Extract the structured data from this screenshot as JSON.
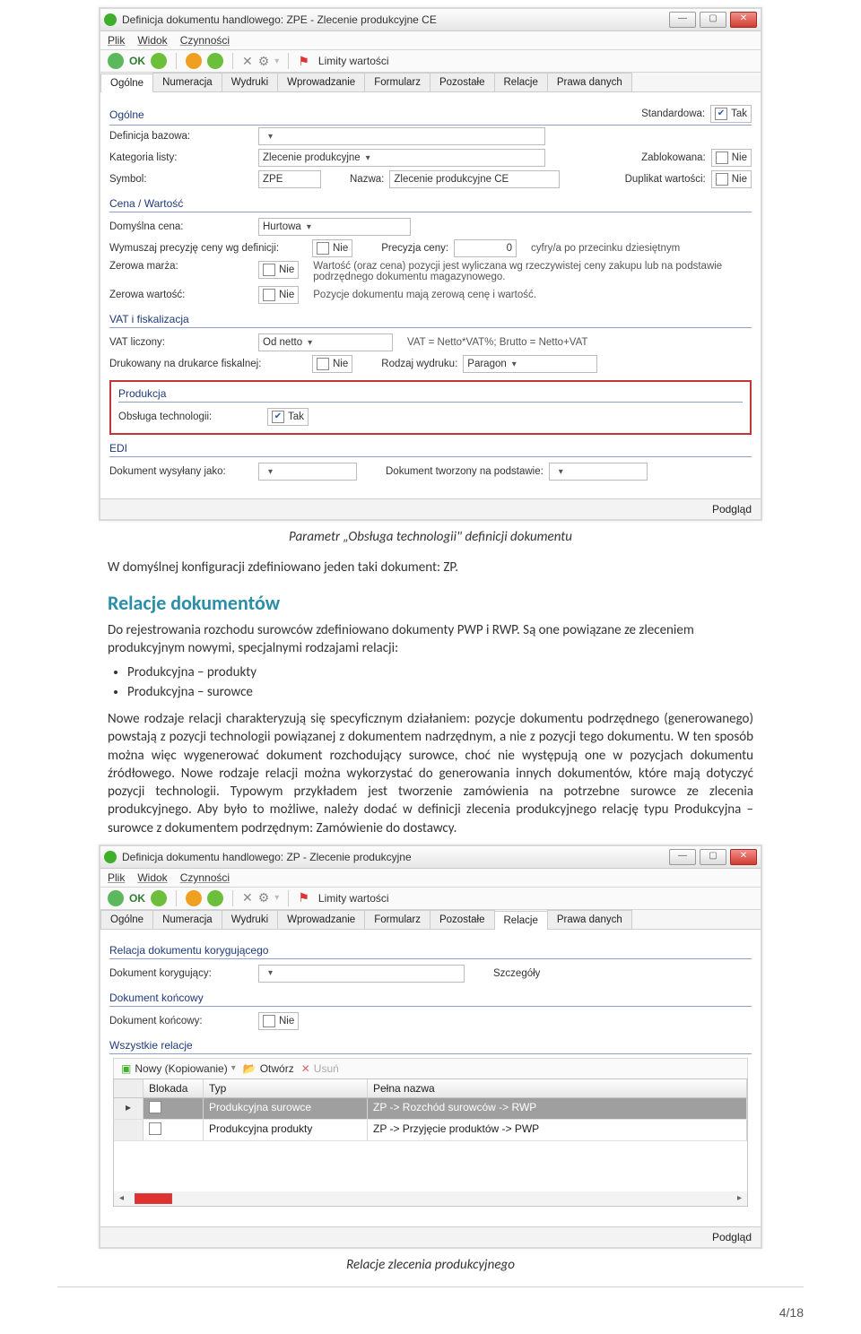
{
  "shot1": {
    "title": "Definicja dokumentu handlowego: ZPE - Zlecenie produkcyjne CE",
    "menu": [
      "Plik",
      "Widok",
      "Czynności"
    ],
    "toolbar": {
      "ok": "OK",
      "limity": "Limity wartości"
    },
    "tabs": [
      "Ogólne",
      "Numeracja",
      "Wydruki",
      "Wprowadzanie",
      "Formularz",
      "Pozostałe",
      "Relacje",
      "Prawa danych"
    ],
    "group_ogolne": "Ogólne",
    "standardowa_lbl": "Standardowa:",
    "standardowa_val": "Tak",
    "def_bazowa_lbl": "Definicja bazowa:",
    "kategoria_lbl": "Kategoria listy:",
    "kategoria_val": "Zlecenie produkcyjne",
    "zablokowana_lbl": "Zablokowana:",
    "zablokowana_val": "Nie",
    "symbol_lbl": "Symbol:",
    "symbol_val": "ZPE",
    "nazwa_lbl": "Nazwa:",
    "nazwa_val": "Zlecenie produkcyjne CE",
    "duplikat_lbl": "Duplikat wartości:",
    "duplikat_val": "Nie",
    "group_cena": "Cena / Wartość",
    "cena_lbl": "Domyślna cena:",
    "cena_val": "Hurtowa",
    "precyzja_def_lbl": "Wymuszaj precyzję ceny wg definicji:",
    "precyzja_def_val": "Nie",
    "precyzja_lbl": "Precyzja ceny:",
    "precyzja_val": "0",
    "precyzja_note": "cyfry/a po przecinku dziesiętnym",
    "zerowa_marza_lbl": "Zerowa marża:",
    "zerowa_marza_val": "Nie",
    "zerowa_marza_note": "Wartość (oraz cena) pozycji jest wyliczana wg rzeczywistej ceny zakupu lub na podstawie podrzędnego dokumentu magazynowego.",
    "zerowa_wartosc_lbl": "Zerowa wartość:",
    "zerowa_wartosc_val": "Nie",
    "zerowa_wartosc_note": "Pozycje dokumentu mają zerową cenę i wartość.",
    "group_vat": "VAT i fiskalizacja",
    "vat_liczony_lbl": "VAT liczony:",
    "vat_liczony_val": "Od netto",
    "vat_note": "VAT = Netto*VAT%; Brutto = Netto+VAT",
    "drukarka_lbl": "Drukowany na drukarce fiskalnej:",
    "drukarka_val": "Nie",
    "rodzaj_wydruku_lbl": "Rodzaj wydruku:",
    "rodzaj_wydruku_val": "Paragon",
    "group_produkcja": "Produkcja",
    "obsluga_tech_lbl": "Obsługa technologii:",
    "obsluga_tech_val": "Tak",
    "group_edi": "EDI",
    "edi_wysylany_lbl": "Dokument wysyłany jako:",
    "edi_tworzony_lbl": "Dokument tworzony na podstawie:",
    "podglad": "Podgląd"
  },
  "doc": {
    "caption1": "Parametr „Obsługa technologii\" definicji dokumentu",
    "p1": "W domyślnej konfiguracji zdefiniowano jeden taki dokument: ZP.",
    "h2": "Relacje dokumentów",
    "p2": "Do rejestrowania rozchodu surowców zdefiniowano dokumenty PWP i RWP. Są one powiązane ze zleceniem produkcyjnym nowymi, specjalnymi rodzajami relacji:",
    "li1": "Produkcyjna – produkty",
    "li2": "Produkcyjna – surowce",
    "p3": "Nowe rodzaje relacji charakteryzują się specyficznym działaniem: pozycje dokumentu podrzędnego (generowanego) powstają z pozycji technologii powiązanej z dokumentem nadrzędnym, a nie z pozycji tego dokumentu. W ten sposób można więc wygenerować dokument rozchodujący surowce, choć nie występują one w pozycjach dokumentu źródłowego. Nowe rodzaje relacji można wykorzystać do generowania innych dokumentów, które mają dotyczyć pozycji technologii. Typowym przykładem jest tworzenie zamówienia na potrzebne surowce ze zlecenia produkcyjnego. Aby było to możliwe, należy dodać w definicji zlecenia produkcyjnego relację typu Produkcyjna – surowce z dokumentem podrzędnym: Zamówienie do dostawcy.",
    "caption2": "Relacje zlecenia produkcyjnego",
    "page": "4/18"
  },
  "shot2": {
    "title": "Definicja dokumentu handlowego: ZP - Zlecenie produkcyjne",
    "menu": [
      "Plik",
      "Widok",
      "Czynności"
    ],
    "toolbar": {
      "ok": "OK",
      "limity": "Limity wartości"
    },
    "tabs": [
      "Ogólne",
      "Numeracja",
      "Wydruki",
      "Wprowadzanie",
      "Formularz",
      "Pozostałe",
      "Relacje",
      "Prawa danych"
    ],
    "group_korygujacy": "Relacja dokumentu korygującego",
    "kor_lbl": "Dokument korygujący:",
    "szczegoly": "Szczegóły",
    "group_koncowy": "Dokument końcowy",
    "koncowy_lbl": "Dokument końcowy:",
    "koncowy_val": "Nie",
    "group_wszystkie": "Wszystkie relacje",
    "grid_toolbar": {
      "nowy": "Nowy (Kopiowanie)",
      "otworz": "Otwórz",
      "usun": "Usuń"
    },
    "grid_head": [
      "Blokada",
      "Typ",
      "Pełna nazwa"
    ],
    "grid_rows": [
      {
        "blokada": "",
        "typ": "Produkcyjna surowce",
        "nazwa": "ZP -> Rozchód surowców -> RWP",
        "selected": true
      },
      {
        "blokada": "",
        "typ": "Produkcyjna produkty",
        "nazwa": "ZP -> Przyjęcie produktów -> PWP",
        "selected": false
      }
    ],
    "podglad": "Podgląd"
  }
}
